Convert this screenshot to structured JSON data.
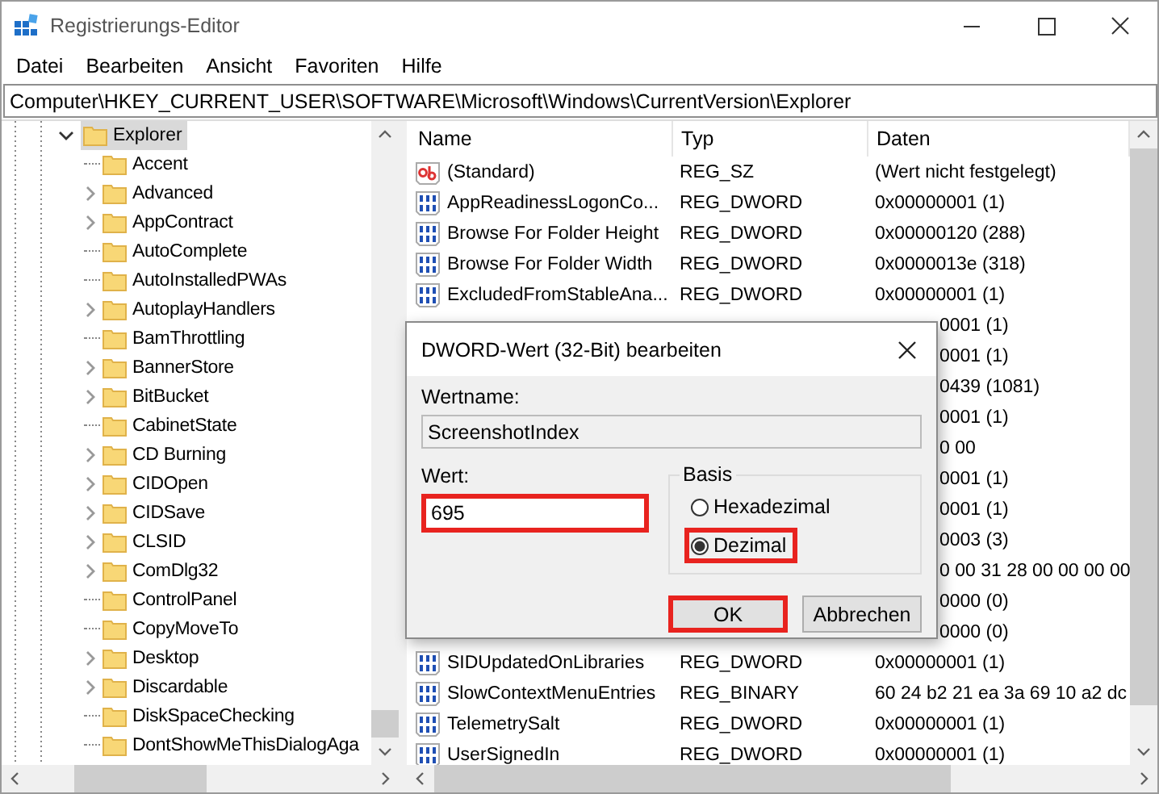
{
  "window": {
    "title": "Registrierungs-Editor"
  },
  "menu": [
    "Datei",
    "Bearbeiten",
    "Ansicht",
    "Favoriten",
    "Hilfe"
  ],
  "address": "Computer\\HKEY_CURRENT_USER\\SOFTWARE\\Microsoft\\Windows\\CurrentVersion\\Explorer",
  "tree": {
    "label": "Explorer",
    "expanded": true,
    "selected": true,
    "children": [
      {
        "label": "Accent",
        "expandable": false,
        "selected": false
      },
      {
        "label": "Advanced",
        "expandable": true,
        "selected": false
      },
      {
        "label": "AppContract",
        "expandable": true,
        "selected": false
      },
      {
        "label": "AutoComplete",
        "expandable": false,
        "selected": false
      },
      {
        "label": "AutoInstalledPWAs",
        "expandable": false,
        "selected": false
      },
      {
        "label": "AutoplayHandlers",
        "expandable": true,
        "selected": false
      },
      {
        "label": "BamThrottling",
        "expandable": false,
        "selected": false
      },
      {
        "label": "BannerStore",
        "expandable": true,
        "selected": false
      },
      {
        "label": "BitBucket",
        "expandable": true,
        "selected": false
      },
      {
        "label": "CabinetState",
        "expandable": false,
        "selected": false
      },
      {
        "label": "CD Burning",
        "expandable": true,
        "selected": false
      },
      {
        "label": "CIDOpen",
        "expandable": true,
        "selected": false
      },
      {
        "label": "CIDSave",
        "expandable": true,
        "selected": false
      },
      {
        "label": "CLSID",
        "expandable": true,
        "selected": false
      },
      {
        "label": "ComDlg32",
        "expandable": true,
        "selected": false
      },
      {
        "label": "ControlPanel",
        "expandable": false,
        "selected": false
      },
      {
        "label": "CopyMoveTo",
        "expandable": false,
        "selected": false
      },
      {
        "label": "Desktop",
        "expandable": true,
        "selected": false
      },
      {
        "label": "Discardable",
        "expandable": true,
        "selected": false
      },
      {
        "label": "DiskSpaceChecking",
        "expandable": false,
        "selected": false
      },
      {
        "label": "DontShowMeThisDialogAga",
        "expandable": false,
        "selected": false
      }
    ]
  },
  "list": {
    "columns": [
      "Name",
      "Typ",
      "Daten"
    ],
    "rows": [
      {
        "kind": "sz",
        "name": "(Standard)",
        "type": "REG_SZ",
        "data": "(Wert nicht festgelegt)"
      },
      {
        "kind": "dword",
        "name": "AppReadinessLogonCo...",
        "type": "REG_DWORD",
        "data": "0x00000001 (1)"
      },
      {
        "kind": "dword",
        "name": "Browse For Folder Height",
        "type": "REG_DWORD",
        "data": "0x00000120 (288)"
      },
      {
        "kind": "dword",
        "name": "Browse For Folder Width",
        "type": "REG_DWORD",
        "data": "0x0000013e (318)"
      },
      {
        "kind": "dword",
        "name": "ExcludedFromStableAna...",
        "type": "REG_DWORD",
        "data": "0x00000001 (1)"
      },
      {
        "kind": "covered",
        "data": "0001 (1)"
      },
      {
        "kind": "covered",
        "data": "0001 (1)"
      },
      {
        "kind": "covered",
        "data": "0439 (1081)"
      },
      {
        "kind": "covered",
        "data": "0001 (1)"
      },
      {
        "kind": "covered",
        "data": "0 00"
      },
      {
        "kind": "covered",
        "data": "0001 (1)"
      },
      {
        "kind": "covered",
        "data": "0001 (1)"
      },
      {
        "kind": "covered",
        "data": "0003 (3)"
      },
      {
        "kind": "covered",
        "data": "0 00 31 28 00 00 00 00"
      },
      {
        "kind": "covered",
        "data": "0000 (0)"
      },
      {
        "kind": "covered",
        "data": "0000 (0)"
      },
      {
        "kind": "dword",
        "name": "SIDUpdatedOnLibraries",
        "type": "REG_DWORD",
        "data": "0x00000001 (1)"
      },
      {
        "kind": "binary",
        "name": "SlowContextMenuEntries",
        "type": "REG_BINARY",
        "data": "60 24 b2 21 ea 3a 69 10 a2 dc"
      },
      {
        "kind": "dword",
        "name": "TelemetrySalt",
        "type": "REG_DWORD",
        "data": "0x00000001 (1)"
      },
      {
        "kind": "dword",
        "name": "UserSignedIn",
        "type": "REG_DWORD",
        "data": "0x00000001 (1)"
      }
    ]
  },
  "dialog": {
    "title": "DWORD-Wert (32-Bit) bearbeiten",
    "name_label": "Wertname:",
    "name_value": "ScreenshotIndex",
    "value_label": "Wert:",
    "value": "695",
    "value_highlighted": true,
    "base_label": "Basis",
    "bases": [
      {
        "label": "Hexadezimal",
        "selected": false,
        "highlighted": false
      },
      {
        "label": "Dezimal",
        "selected": true,
        "highlighted": true
      }
    ],
    "buttons": [
      {
        "label": "OK",
        "default": true,
        "highlighted": true
      },
      {
        "label": "Abbrechen",
        "default": false,
        "highlighted": false
      }
    ]
  }
}
